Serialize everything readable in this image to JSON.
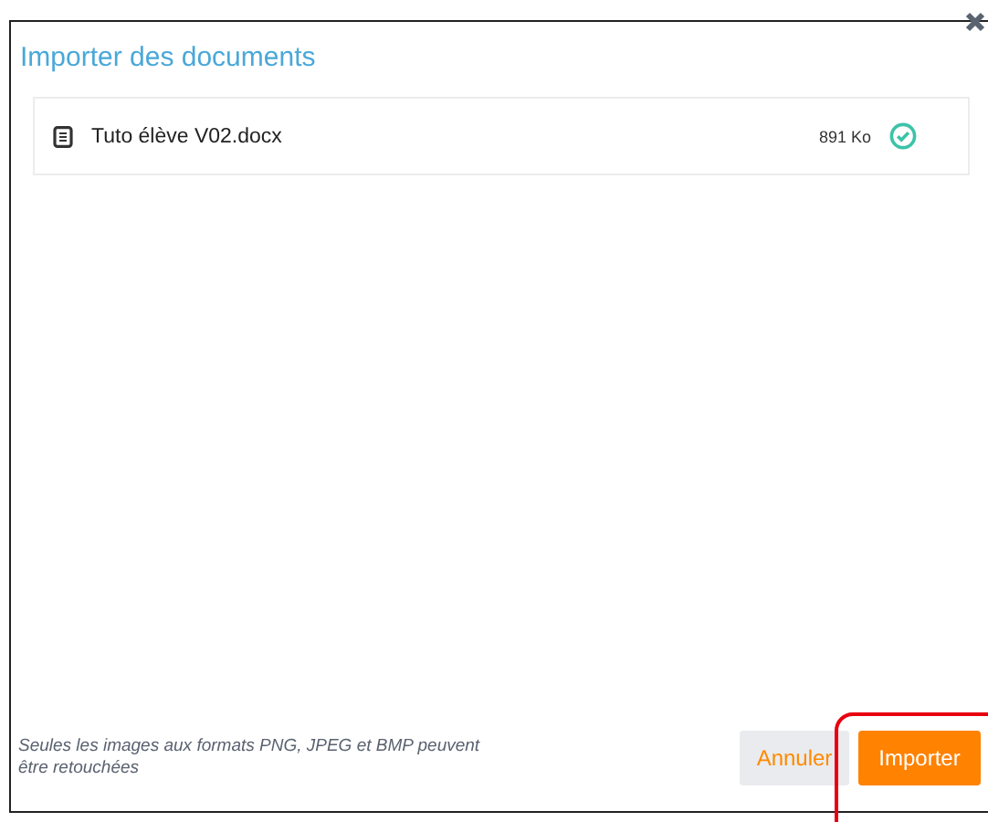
{
  "dialog": {
    "title": "Importer des documents"
  },
  "files": [
    {
      "name": "Tuto élève V02.docx",
      "size": "891 Ko",
      "done": true
    }
  ],
  "footer": {
    "note": "Seules les images aux formats PNG, JPEG et BMP peuvent être retouchées",
    "buttons": [
      {
        "label": "Annuler",
        "kind": "secondary"
      },
      {
        "label": "Importer",
        "kind": "primary"
      }
    ]
  }
}
